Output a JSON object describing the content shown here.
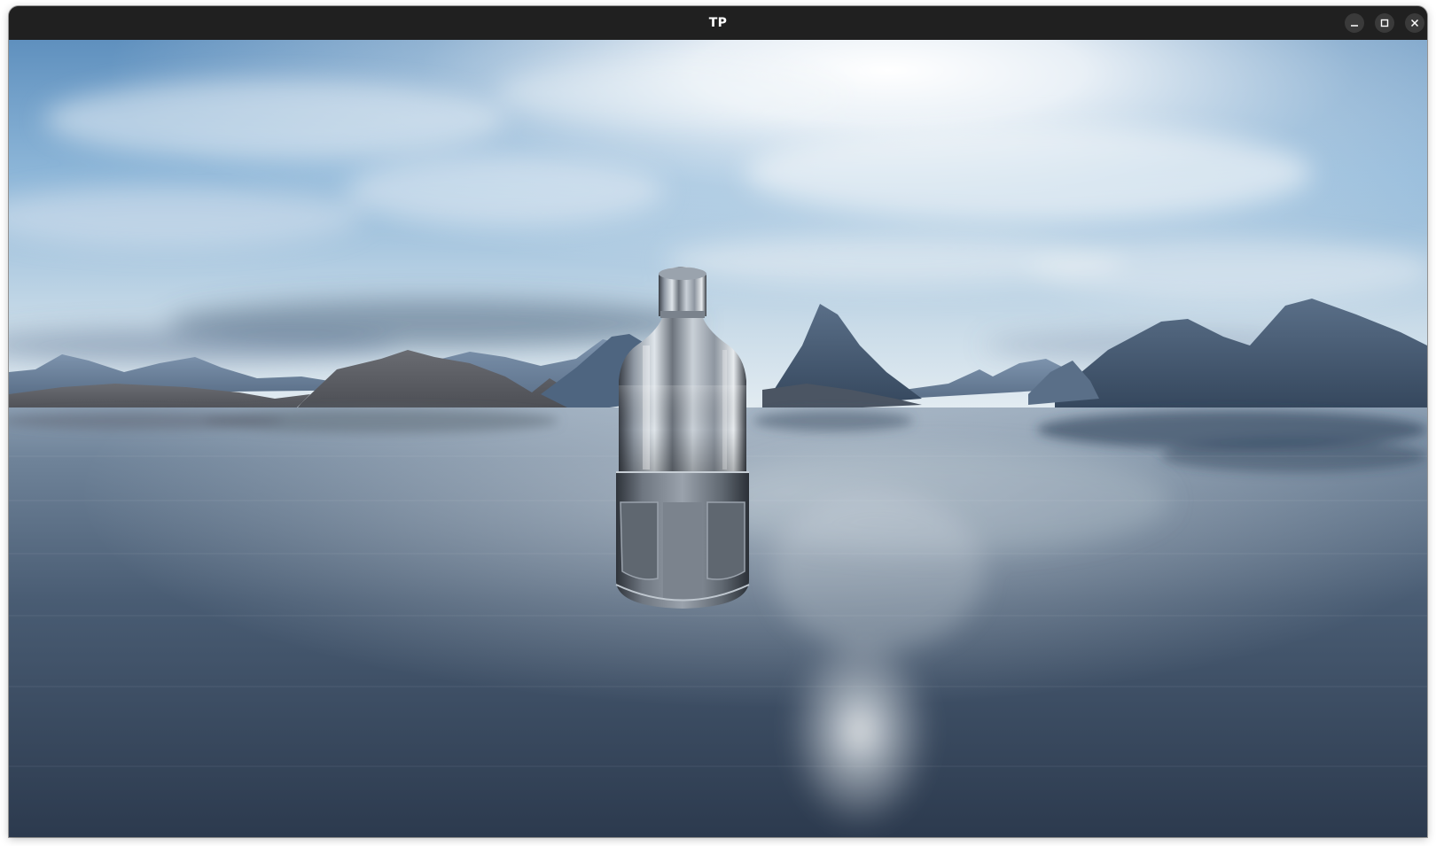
{
  "window": {
    "title": "TP"
  },
  "controls": {
    "minimize_icon": "minimize-icon",
    "maximize_icon": "maximize-icon",
    "close_icon": "close-icon"
  },
  "scene": {
    "sky_color": "#9fc2df",
    "water_color": "#3c4f66",
    "object": "metal bottle"
  }
}
